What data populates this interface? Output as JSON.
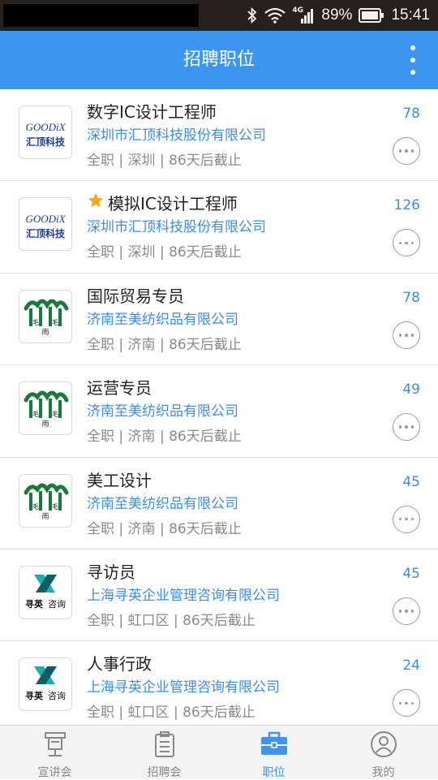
{
  "status_bar": {
    "battery": "89%",
    "time": "15:41",
    "network": "4G"
  },
  "app_bar": {
    "title": "招聘职位"
  },
  "jobs": [
    {
      "title": "数字IC设计工程师",
      "starred": false,
      "company": "深圳市汇顶科技股份有限公司",
      "meta": "全职 | 深圳 | 86天后截止",
      "count": "78",
      "logo": "goodix",
      "logo_text": [
        "GOODiX",
        "汇顶科技"
      ]
    },
    {
      "title": "模拟IC设计工程师",
      "starred": true,
      "company": "深圳市汇顶科技股份有限公司",
      "meta": "全职 | 深圳 | 86天后截止",
      "count": "126",
      "logo": "goodix",
      "logo_text": [
        "GOODiX",
        "汇顶科技"
      ]
    },
    {
      "title": "国际贸易专员",
      "starred": false,
      "company": "济南至美纺织品有限公司",
      "meta": "全职 | 济南 | 86天后截止",
      "count": "78",
      "logo": "maomaoyu",
      "logo_text": [
        "毛",
        "毛",
        "雨"
      ]
    },
    {
      "title": "运营专员",
      "starred": false,
      "company": "济南至美纺织品有限公司",
      "meta": "全职 | 济南 | 86天后截止",
      "count": "49",
      "logo": "maomaoyu",
      "logo_text": [
        "毛",
        "毛",
        "雨"
      ]
    },
    {
      "title": "美工设计",
      "starred": false,
      "company": "济南至美纺织品有限公司",
      "meta": "全职 | 济南 | 86天后截止",
      "count": "45",
      "logo": "maomaoyu",
      "logo_text": [
        "毛",
        "毛",
        "雨"
      ]
    },
    {
      "title": "寻访员",
      "starred": false,
      "company": "上海寻英企业管理咨询有限公司",
      "meta": "全职 | 虹口区 | 86天后截止",
      "count": "45",
      "logo": "xunying",
      "logo_text": [
        "寻英",
        "咨询"
      ]
    },
    {
      "title": "人事行政",
      "starred": false,
      "company": "上海寻英企业管理咨询有限公司",
      "meta": "全职 | 虹口区 | 86天后截止",
      "count": "24",
      "logo": "xunying",
      "logo_text": [
        "寻英",
        "咨询"
      ]
    }
  ],
  "tabs": [
    {
      "label": "宣讲会",
      "icon": "lectern-icon",
      "active": false
    },
    {
      "label": "招聘会",
      "icon": "clipboard-icon",
      "active": false
    },
    {
      "label": "职位",
      "icon": "briefcase-icon",
      "active": true
    },
    {
      "label": "我的",
      "icon": "profile-icon",
      "active": false
    }
  ],
  "colors": {
    "accent": "#3c96f0",
    "link": "#3a8de0",
    "star": "#f5a623",
    "goodix_blue": "#1d3c8c",
    "maomaoyu_green": "#1a7a3c",
    "xunying_teal": "#1ab0b0"
  }
}
